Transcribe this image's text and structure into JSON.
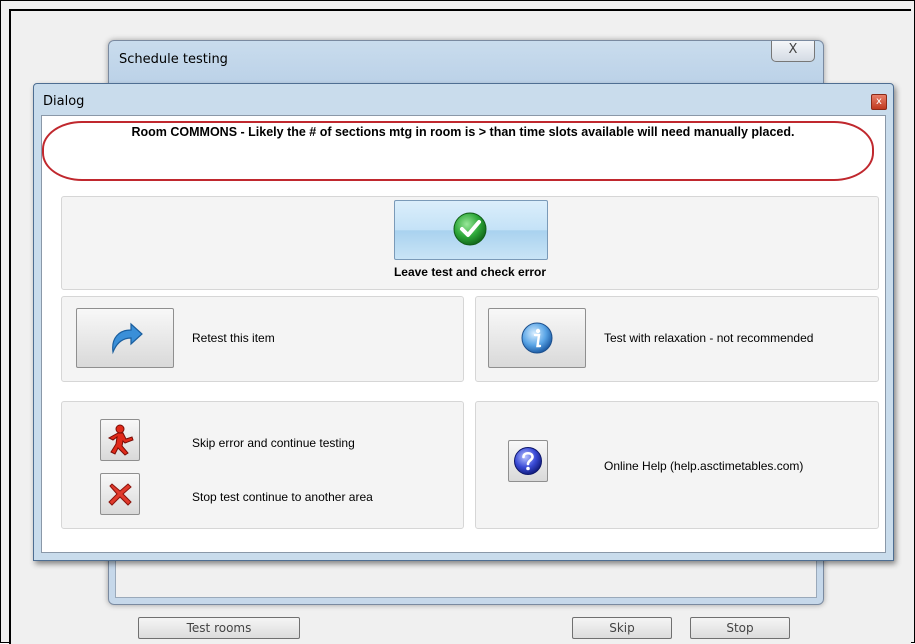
{
  "background_window": {
    "title": "Schedule testing",
    "close_glyph": "X",
    "buttons": {
      "test_rooms": "Test rooms",
      "skip": "Skip",
      "stop": "Stop"
    }
  },
  "dialog": {
    "title": "Dialog",
    "close_glyph": "x",
    "message": "Room COMMONS - Likely the # of sections mtg in room is > than time slots available  will need manually placed.",
    "leave_label": "Leave test and check error",
    "retest_label": "Retest this item",
    "relax_label": "Test with relaxation - not recommended",
    "skip_label": "Skip error and continue testing",
    "stop_label": "Stop test  continue to another area",
    "help_label": "Online Help (help.asctimetables.com)"
  },
  "icons": {
    "leave": "green-check-icon",
    "retest": "blue-curved-arrow-icon",
    "relax": "info-icon",
    "skip": "red-running-man-icon",
    "stop": "red-x-icon",
    "help": "question-icon"
  },
  "colors": {
    "highlight": "#c0282e",
    "button_blue": "#c4e2f7",
    "check_green": "#2ea83a"
  }
}
